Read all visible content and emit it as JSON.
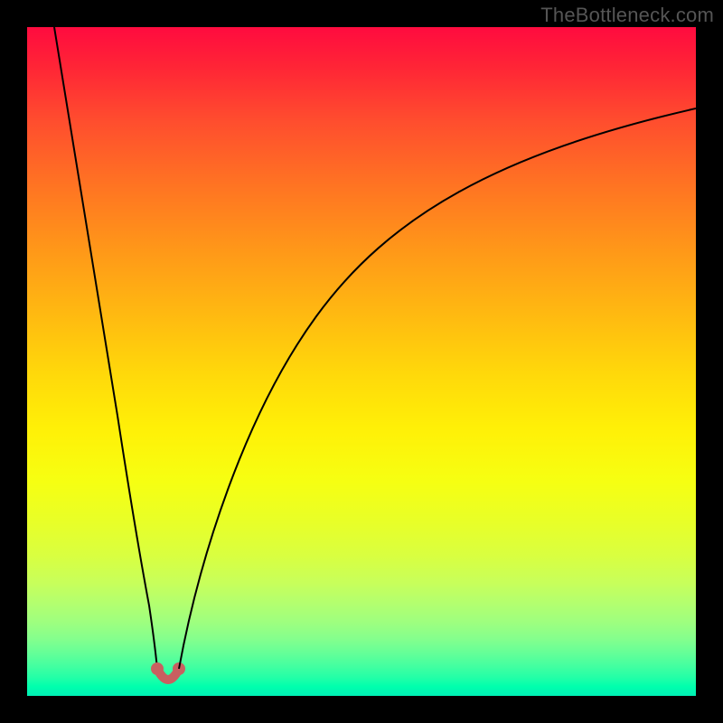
{
  "watermark": "TheBottleneck.com",
  "colors": {
    "page_bg": "#000000",
    "watermark_text": "#555555",
    "curve_stroke": "#000000",
    "valley_marker": "#c86060",
    "gradient_top": "#ff0b3f",
    "gradient_bottom": "#00f0b5"
  },
  "chart_data": {
    "type": "line",
    "title": "",
    "xlabel": "",
    "ylabel": "",
    "xlim": [
      0,
      100
    ],
    "ylim": [
      0,
      100
    ],
    "grid": false,
    "legend": false,
    "annotations": [
      {
        "text": "TheBottleneck.com",
        "position": "top-right"
      }
    ],
    "background_gradient": {
      "direction": "vertical",
      "stops": [
        {
          "pos": 0,
          "hex": "#ff0b3f"
        },
        {
          "pos": 50,
          "hex": "#ffd90a"
        },
        {
          "pos": 80,
          "hex": "#d9ff40"
        },
        {
          "pos": 100,
          "hex": "#00f0b5"
        }
      ]
    },
    "series": [
      {
        "name": "left-branch",
        "x": [
          4,
          6,
          8,
          10,
          12,
          14,
          16,
          18,
          19.2
        ],
        "values": [
          100,
          84,
          68,
          52,
          38,
          25,
          14,
          6,
          2
        ]
      },
      {
        "name": "right-branch",
        "x": [
          22.6,
          24,
          26,
          30,
          35,
          40,
          46,
          54,
          64,
          76,
          88,
          100
        ],
        "values": [
          2,
          7,
          15,
          29,
          42,
          52,
          60,
          68,
          75,
          81,
          85,
          88
        ]
      }
    ],
    "minimum": {
      "x_left": 19.2,
      "x_right": 22.6,
      "value": 2,
      "marker_color": "#c86060"
    }
  }
}
